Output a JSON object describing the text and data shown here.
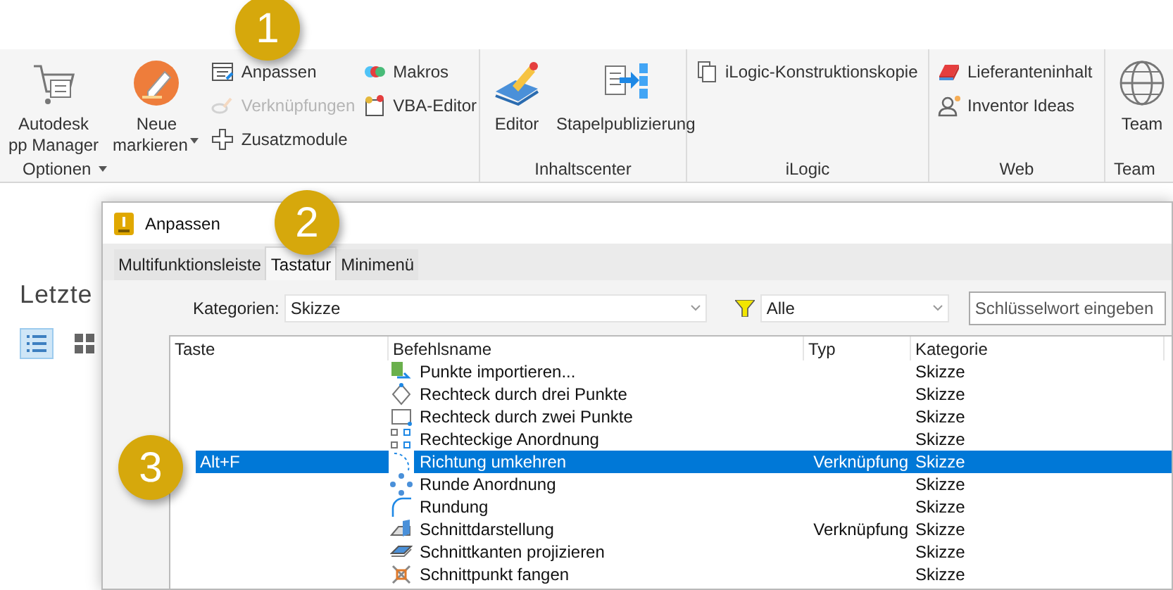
{
  "ribbon": {
    "groups": [
      {
        "label": "Optionen",
        "dropdown": true,
        "columns": [
          {
            "kind": "large",
            "lines": [
              "Autodesk",
              "pp Manager"
            ]
          },
          {
            "kind": "large",
            "lines": [
              "Neue",
              "markieren"
            ],
            "dropdown": true
          },
          {
            "kind": "stack",
            "items": [
              {
                "label": "Anpassen",
                "disabled": false
              },
              {
                "label": "Verknüpfungen",
                "disabled": true
              },
              {
                "label": "Zusatzmodule",
                "disabled": false
              }
            ]
          },
          {
            "kind": "stack",
            "items": [
              {
                "label": "Makros",
                "disabled": false
              },
              {
                "label": "VBA-Editor",
                "disabled": false
              }
            ]
          }
        ]
      },
      {
        "label": "Inhaltscenter",
        "dropdown": false,
        "columns": [
          {
            "kind": "large",
            "lines": [
              "Editor"
            ]
          },
          {
            "kind": "large",
            "lines": [
              "Stapelpublizierung"
            ]
          }
        ]
      },
      {
        "label": "iLogic",
        "dropdown": false,
        "columns": [
          {
            "kind": "stack",
            "items": [
              {
                "label": "iLogic-Konstruktionskopie",
                "disabled": false
              }
            ]
          }
        ]
      },
      {
        "label": "Web",
        "dropdown": false,
        "columns": [
          {
            "kind": "stack",
            "items": [
              {
                "label": "Lieferanteninhalt",
                "disabled": false
              },
              {
                "label": "Inventor Ideas",
                "disabled": false
              }
            ]
          }
        ]
      },
      {
        "label": "Team",
        "dropdown": false,
        "columns": [
          {
            "kind": "large",
            "lines": [
              "Team"
            ]
          }
        ]
      }
    ]
  },
  "home": {
    "heading": "Letzte",
    "view_buttons": [
      {
        "selected": true
      },
      {
        "selected": false
      }
    ]
  },
  "dialog": {
    "title": "Anpassen",
    "tabs": [
      {
        "label": "Multifunktionsleiste",
        "selected": false
      },
      {
        "label": "Tastatur",
        "selected": true
      },
      {
        "label": "Minimenü",
        "selected": false
      }
    ],
    "category_label": "Kategorien:",
    "category_value": "Skizze",
    "filter_value": "Alle",
    "search": {
      "placeholder": "Schlüsselwort eingeben"
    },
    "table": {
      "columns": [
        "Taste",
        "Befehlsname",
        "Typ",
        "Kategorie"
      ],
      "rows": [
        {
          "key": "",
          "command": "Punkte importieren...",
          "type": "",
          "category": "Skizze",
          "selected": false
        },
        {
          "key": "",
          "command": "Rechteck durch drei Punkte",
          "type": "",
          "category": "Skizze",
          "selected": false
        },
        {
          "key": "",
          "command": "Rechteck durch zwei Punkte",
          "type": "",
          "category": "Skizze",
          "selected": false
        },
        {
          "key": "",
          "command": "Rechteckige Anordnung",
          "type": "",
          "category": "Skizze",
          "selected": false
        },
        {
          "key": "Alt+F",
          "command": "Richtung umkehren",
          "type": "Verknüpfung",
          "category": "Skizze",
          "selected": true
        },
        {
          "key": "",
          "command": "Runde Anordnung",
          "type": "",
          "category": "Skizze",
          "selected": false
        },
        {
          "key": "",
          "command": "Rundung",
          "type": "",
          "category": "Skizze",
          "selected": false
        },
        {
          "key": "",
          "command": "Schnittdarstellung",
          "type": "Verknüpfung",
          "category": "Skizze",
          "selected": false
        },
        {
          "key": "",
          "command": "Schnittkanten projizieren",
          "type": "",
          "category": "Skizze",
          "selected": false
        },
        {
          "key": "",
          "command": "Schnittpunkt fangen",
          "type": "",
          "category": "Skizze",
          "selected": false
        }
      ]
    }
  },
  "callouts": [
    {
      "text": "1"
    },
    {
      "text": "2"
    },
    {
      "text": "3"
    }
  ]
}
